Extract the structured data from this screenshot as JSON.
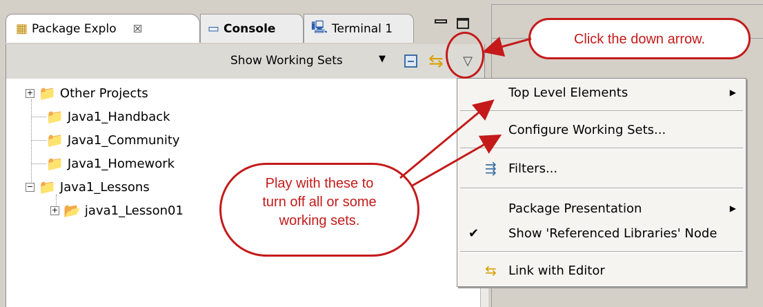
{
  "tabs": [
    {
      "label": "Package Explo",
      "close": "☒",
      "icon": "package-explorer-icon"
    },
    {
      "label": "Console",
      "icon": "console-icon"
    },
    {
      "label": "Terminal 1",
      "icon": "terminal-icon"
    }
  ],
  "toolbar": {
    "working_sets_label": "Show Working Sets",
    "working_sets_arrow": "▼",
    "menu_arrow": "▽"
  },
  "tree": [
    {
      "label": "Other Projects",
      "expander": "+"
    },
    {
      "label": "Java1_Handback"
    },
    {
      "label": "Java1_Community"
    },
    {
      "label": "Java1_Homework"
    },
    {
      "label": "Java1_Lessons",
      "expander": "−"
    },
    {
      "label": "java1_Lesson01",
      "expander": "+"
    }
  ],
  "menu": {
    "items": [
      {
        "label": "Top Level Elements",
        "submenu": "▶"
      },
      {
        "label": "Configure Working Sets..."
      },
      {
        "label": "Filters...",
        "icon": "filter-icon"
      },
      {
        "label": "Package Presentation",
        "submenu": "▶"
      },
      {
        "label": "Show 'Referenced Libraries' Node",
        "check": "✔"
      },
      {
        "label": "Link with Editor",
        "icon": "link-icon"
      }
    ]
  },
  "callouts": {
    "top": "Click the down arrow.",
    "mid_lines": [
      "Play with these to",
      "turn off all or some",
      "working sets."
    ]
  },
  "colors": {
    "callout_red": "#c41a1a",
    "chrome_gray": "#d4d0c8",
    "menu_bg": "#f5f4f0"
  }
}
